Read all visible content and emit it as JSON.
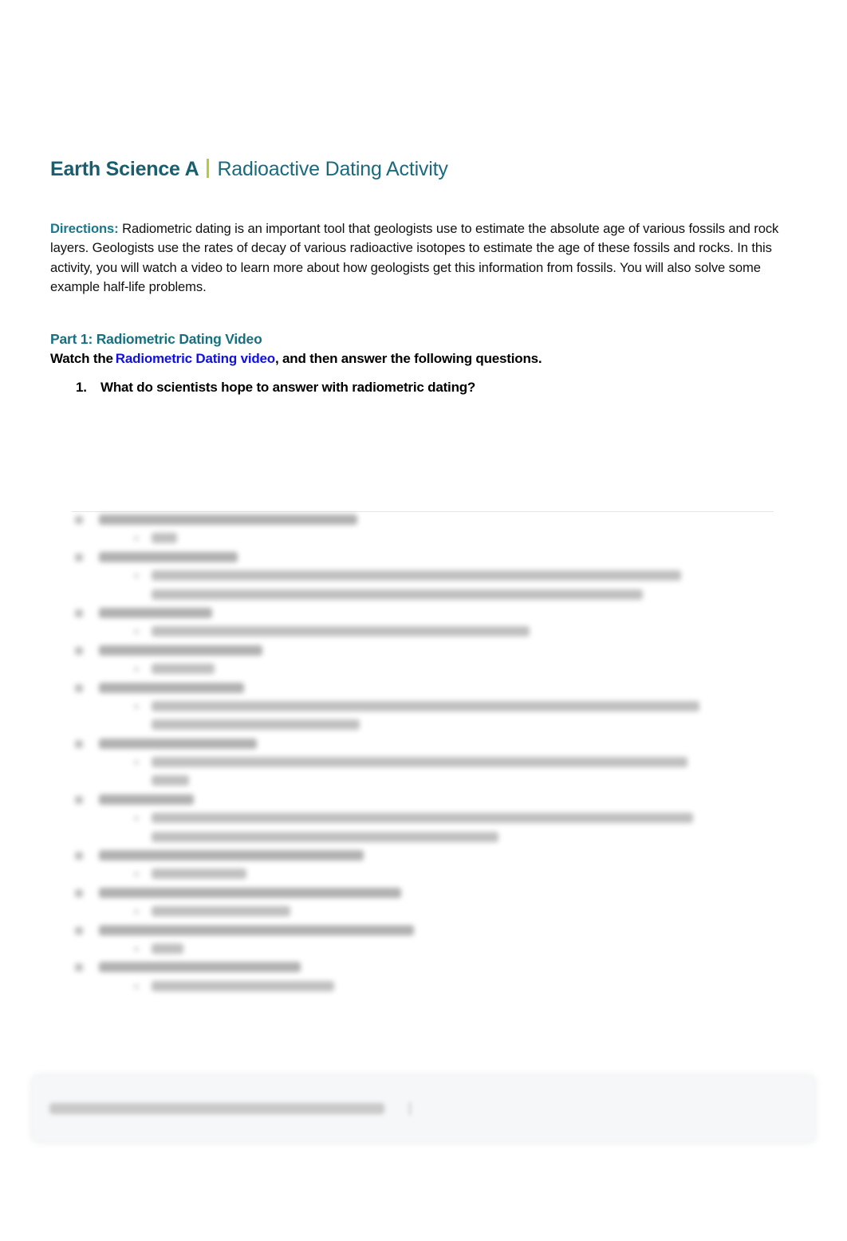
{
  "header": {
    "course": "Earth Science A",
    "activity": "Radioactive Dating Activity"
  },
  "colors": {
    "title_teal": "#175e6e",
    "separator_green": "#b5cc3a",
    "directions_label": "#17788e",
    "link_blue": "#1010e0"
  },
  "directions": {
    "label": "Directions:",
    "text": "Radiometric dating is an important tool that geologists use to estimate the absolute age of various fossils and rock layers. Geologists use the rates of decay of various radioactive isotopes to estimate the age of these fossils and rocks. In this activity, you will watch a video to learn more about how geologists get this information from fossils. You will also solve some example half-life problems."
  },
  "part1": {
    "heading": "Part 1: Radiometric Dating Video",
    "instruction_before": "Watch the",
    "link_text": "Radiometric Dating video",
    "instruction_after": ", and then answer the following questions.",
    "questions": [
      {
        "number": "1.",
        "text": "What do scientists hope to answer with radiometric dating?"
      }
    ]
  },
  "redacted_section": {
    "note": "Remaining questions and answers are blurred and illegible",
    "rows": [
      {
        "type": "q",
        "w": 0.41
      },
      {
        "type": "a",
        "w": 0.04
      },
      {
        "type": "q",
        "w": 0.22
      },
      {
        "type": "a",
        "w": 0.84
      },
      {
        "type": "a2",
        "w": 0.78
      },
      {
        "type": "q",
        "w": 0.18
      },
      {
        "type": "a",
        "w": 0.6
      },
      {
        "type": "q",
        "w": 0.26
      },
      {
        "type": "a",
        "w": 0.1
      },
      {
        "type": "q",
        "w": 0.23
      },
      {
        "type": "a",
        "w": 0.87
      },
      {
        "type": "a2",
        "w": 0.33
      },
      {
        "type": "q",
        "w": 0.25
      },
      {
        "type": "a",
        "w": 0.85
      },
      {
        "type": "a2",
        "w": 0.06
      },
      {
        "type": "q",
        "w": 0.15
      },
      {
        "type": "a",
        "w": 0.86
      },
      {
        "type": "a2",
        "w": 0.55
      },
      {
        "type": "q",
        "w": 0.42
      },
      {
        "type": "a",
        "w": 0.15
      },
      {
        "type": "q",
        "w": 0.48
      },
      {
        "type": "a",
        "w": 0.22
      },
      {
        "type": "q",
        "w": 0.5
      },
      {
        "type": "a",
        "w": 0.05
      },
      {
        "type": "q",
        "w": 0.32
      },
      {
        "type": "a",
        "w": 0.29
      }
    ]
  },
  "footer": {
    "note": "Footer copyright text is blurred and illegible"
  }
}
